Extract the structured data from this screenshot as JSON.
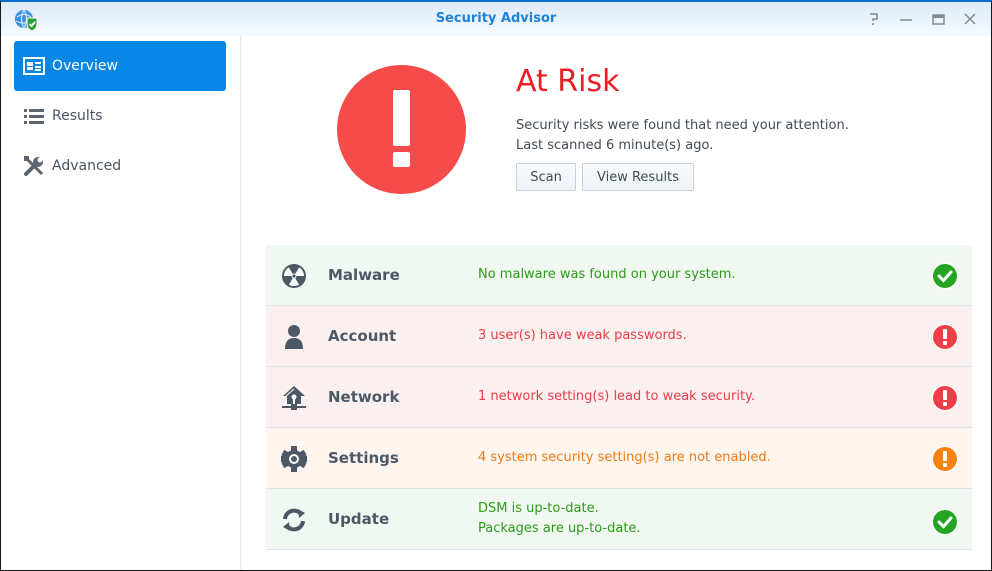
{
  "window": {
    "title": "Security Advisor",
    "controls": [
      "help",
      "minimize",
      "maximize",
      "close"
    ],
    "accent_color": "#0687e6"
  },
  "sidebar": {
    "items": [
      {
        "label": "Overview",
        "icon": "id-card-icon",
        "active": true
      },
      {
        "label": "Results",
        "icon": "list-icon",
        "active": false
      },
      {
        "label": "Advanced",
        "icon": "tools-icon",
        "active": false
      }
    ]
  },
  "overview": {
    "status_title": "At Risk",
    "status_color": "#ee1c25",
    "description": "Security risks were found that need your attention.",
    "last_scanned": "Last scanned 6 minute(s) ago.",
    "scan_button": "Scan",
    "view_results_button": "View Results"
  },
  "categories": [
    {
      "name": "Malware",
      "icon": "radiation-icon",
      "status": "ok",
      "messages": [
        "No malware was found on your system."
      ]
    },
    {
      "name": "Account",
      "icon": "user-icon",
      "status": "bad",
      "messages": [
        "3 user(s) have weak passwords."
      ]
    },
    {
      "name": "Network",
      "icon": "network-home-icon",
      "status": "bad",
      "messages": [
        "1 network setting(s) lead to weak security."
      ]
    },
    {
      "name": "Settings",
      "icon": "gear-icon",
      "status": "warn",
      "messages": [
        "4 system security setting(s) are not enabled."
      ]
    },
    {
      "name": "Update",
      "icon": "refresh-icon",
      "status": "ok",
      "messages": [
        "DSM is up-to-date.",
        "Packages are up-to-date."
      ]
    }
  ],
  "status_colors": {
    "ok": "#23a523",
    "bad": "#ef3e47",
    "warn": "#f8820f"
  }
}
